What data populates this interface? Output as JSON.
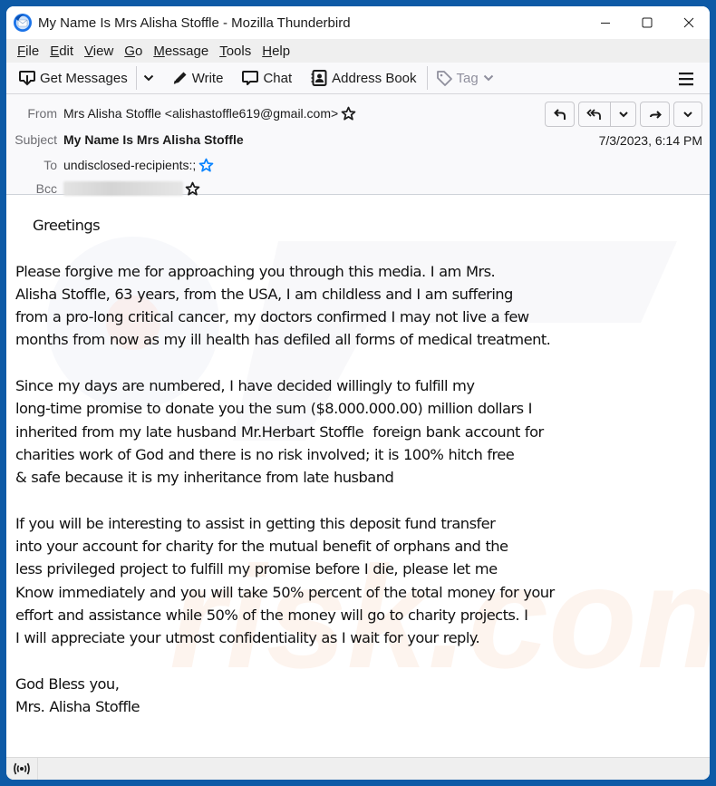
{
  "window": {
    "title": "My Name Is Mrs Alisha Stoffle - Mozilla Thunderbird",
    "app_icon": "thunderbird-logo-icon",
    "controls": [
      "minimize-icon",
      "maximize-icon",
      "close-icon"
    ]
  },
  "menu": {
    "items": [
      {
        "accel": "F",
        "rest": "ile"
      },
      {
        "accel": "E",
        "rest": "dit"
      },
      {
        "accel": "V",
        "rest": "iew"
      },
      {
        "accel": "G",
        "rest": "o"
      },
      {
        "accel": "M",
        "rest": "essage"
      },
      {
        "accel": "T",
        "rest": "ools"
      },
      {
        "accel": "H",
        "rest": "elp"
      }
    ]
  },
  "toolbar": {
    "get_messages": "Get Messages",
    "write": "Write",
    "chat": "Chat",
    "address_book": "Address Book",
    "tag": "Tag"
  },
  "header": {
    "from_label": "From",
    "from_value": "Mrs Alisha Stoffle <alishastoffle619@gmail.com>",
    "subject_label": "Subject",
    "subject_value": "My Name Is Mrs Alisha Stoffle",
    "to_label": "To",
    "to_value": "undisclosed-recipients:;",
    "bcc_label": "Bcc",
    "bcc_value_redacted": true,
    "date": "7/3/2023, 6:14 PM",
    "actions": [
      "reply",
      "reply-all",
      "reply-all-dropdown",
      "forward",
      "more-dropdown"
    ]
  },
  "message": {
    "greeting": "Greetings",
    "paragraphs": [
      [
        "Please forgive me for approaching you through this media. I am Mrs.",
        "Alisha Stoffle, 63 years, from the USA, I am childless and I am suffering",
        "from a pro-long critical cancer, my doctors confirmed I may not live a few",
        "months from now as my ill health has defiled all forms of medical treatment."
      ],
      [
        "Since my days are numbered, I have decided willingly to fulfill my",
        "long-time promise to donate you the sum ($8.000.000.00) million dollars I",
        "inherited from my late husband Mr.Herbart Stoffle  foreign bank account for",
        "charities work of God and there is no risk involved; it is 100% hitch free",
        "& safe because it is my inheritance from late husband"
      ],
      [
        "If you will be interesting to assist in getting this deposit fund transfer",
        "into your account for charity for the mutual benefit of orphans and the",
        "less privileged project to fulfill my promise before I die, please let me",
        "Know immediately and you will take 50% percent of the total money for your",
        "effort and assistance while 50% of the money will go to charity projects. I",
        "I will appreciate your utmost confidentiality as I wait for your reply."
      ],
      [
        "God Bless you,",
        "Mrs. Alisha Stoffle"
      ]
    ]
  },
  "statusbar": {
    "icon": "online-status-icon"
  },
  "colors": {
    "desktop": "#0d5aa6",
    "header_bg": "#f9f9fb",
    "menubar_bg": "#efefef",
    "star_blue": "#0a84ff"
  }
}
